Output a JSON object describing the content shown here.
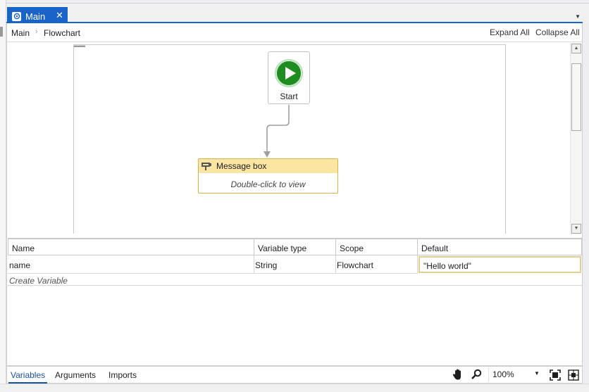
{
  "tab": {
    "title": "Main",
    "close_icon": "close-icon",
    "icon": "workflow-icon"
  },
  "breadcrumb": {
    "root": "Main",
    "separator": "›",
    "current": "Flowchart"
  },
  "header_actions": {
    "expand_all": "Expand All",
    "collapse_all": "Collapse All"
  },
  "flowchart": {
    "start": {
      "label": "Start",
      "icon": "play-icon",
      "color": "#1e8c1e"
    },
    "activity": {
      "title": "Message box",
      "subtitle": "Double-click to view",
      "icon": "message-box-icon",
      "header_color": "#fbe5a2",
      "border_color": "#d6b444"
    }
  },
  "variables": {
    "columns": [
      "Name",
      "Variable type",
      "Scope",
      "Default"
    ],
    "rows": [
      {
        "name": "name",
        "type": "String",
        "scope": "Flowchart",
        "default": "\"Hello world\""
      }
    ],
    "create_label": "Create Variable"
  },
  "bottom_tabs": [
    "Variables",
    "Arguments",
    "Imports"
  ],
  "zoom": {
    "value": "100%"
  },
  "accent_color": "#1a63c8"
}
